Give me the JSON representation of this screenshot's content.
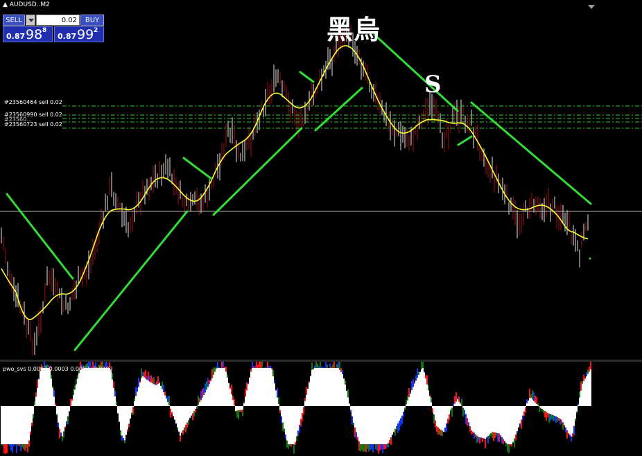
{
  "window": {
    "title": "▲ AUDUSD..M2"
  },
  "trade_panel": {
    "sell_label": "SELL",
    "buy_label": "BUY",
    "lot_value": "0.02",
    "bid": {
      "small": "0.87",
      "big": "98",
      "sup": "8"
    },
    "ask": {
      "small": "0.87",
      "big": "99",
      "sup": "2"
    }
  },
  "orders": [
    {
      "label": "#23560464 sell 0.02"
    },
    {
      "label": "#23560990 sell 0.02"
    },
    {
      "label": "#23560..."
    },
    {
      "label": "#23560723 sell 0.02"
    }
  ],
  "annotations": {
    "kanji": "黑烏",
    "s": "S"
  },
  "indicator": {
    "title": "pwo_svs 0.0002 0.0003 0.0002 -0.0002"
  },
  "colors": {
    "background": "#000000",
    "candle": "#a01010",
    "candle_light": "#e8e8e8",
    "ma": "#ffff33",
    "trend": "#33dd33",
    "order_line": "#33cc33",
    "hline": "#b8b8b8",
    "hist_white": "#ffffff",
    "hist_red": "#ff1111",
    "hist_blue": "#1133ff",
    "hist_green": "#117711"
  }
}
